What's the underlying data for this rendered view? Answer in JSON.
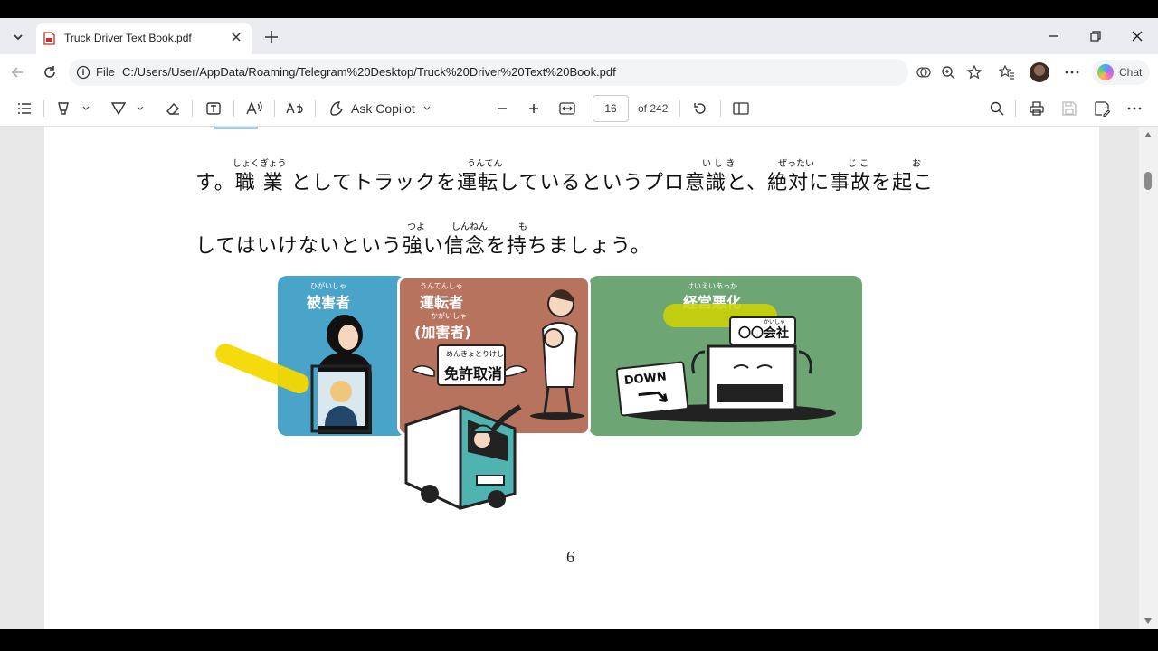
{
  "tab": {
    "title": "Truck Driver Text Book.pdf"
  },
  "address": {
    "scheme_label": "File",
    "url": "C:/Users/User/AppData/Roaming/Telegram%20Desktop/Truck%20Driver%20Text%20Book.pdf"
  },
  "chat_button": {
    "label": "Chat"
  },
  "pdf_toolbar": {
    "ask_copilot_label": "Ask Copilot",
    "page_current": "16",
    "page_total": "of 242"
  },
  "document": {
    "line1": {
      "text": "す。職 業 としてトラックを運転しているというプロ意識と、絶対に事故を起こ",
      "ruby": [
        "しょくぎょう",
        "うんてん",
        "い し き",
        "ぜったい",
        "じ こ",
        "お"
      ]
    },
    "line2": {
      "text": "してはいけないという強い信念を持ちましょう。",
      "ruby": [
        "つよ",
        "しんねん",
        "も"
      ]
    },
    "illustration": {
      "panel1": {
        "label": "被害者",
        "ruby": "ひがいしゃ"
      },
      "panel2": {
        "label": "運転者",
        "ruby": "うんてんしゃ",
        "sub_label": "(加害者)",
        "sub_ruby": "かがいしゃ",
        "sign_ruby": "めんきょとりけし",
        "sign_text": "免許取消"
      },
      "panel3": {
        "label": "経営悪化",
        "ruby": "けいえいあっか",
        "company_sign": "〇〇会社",
        "company_ruby": "かいしゃ",
        "down_sign": "DOWN"
      }
    },
    "page_number": "6"
  },
  "colors": {
    "panel_blue": "#4aa3c8",
    "panel_brown": "#b8735f",
    "panel_green": "#6ea574",
    "highlight": "#f4d800"
  }
}
